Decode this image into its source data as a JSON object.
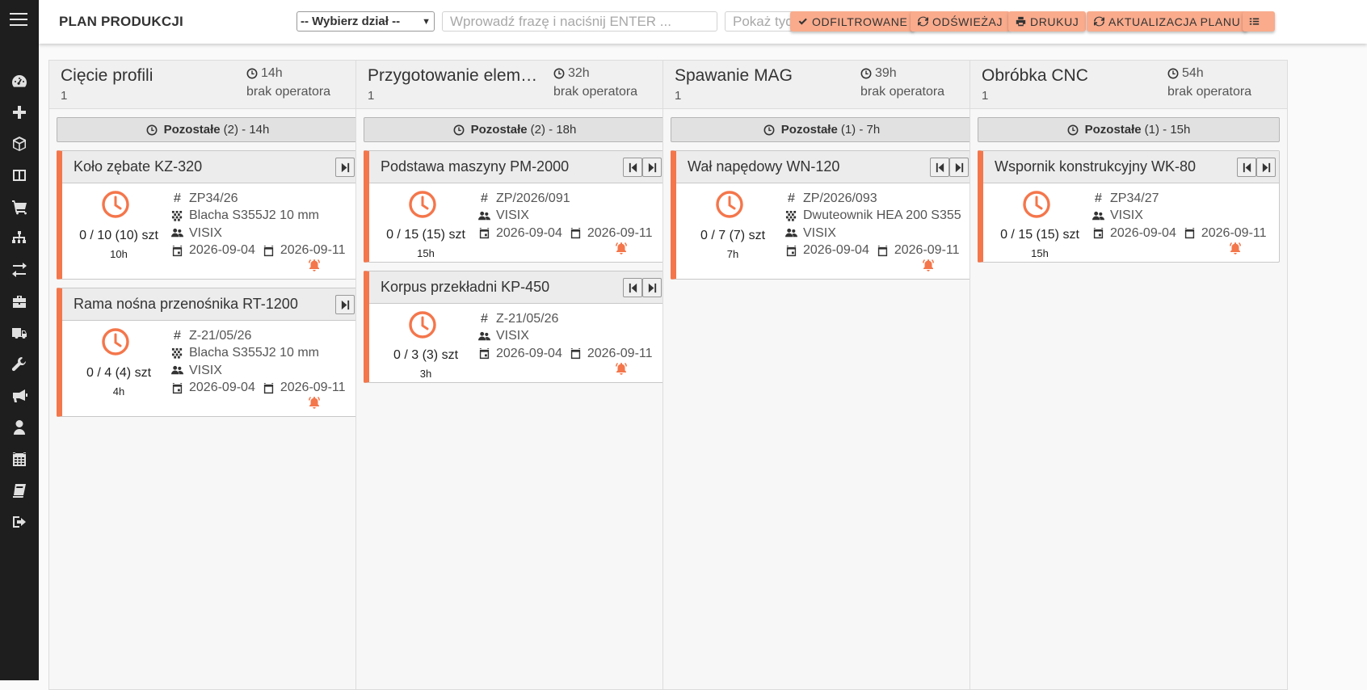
{
  "header": {
    "title": "PLAN PRODUKCJI",
    "dept_select": "-- Wybierz dział --",
    "search_placeholder": "Wprowadź frazę i naciśnij ENTER ...",
    "week_placeholder": "Pokaż tydzień",
    "btn_filtered": "ODFILTROWANE",
    "btn_refresh": "ODŚWIEŻAJ",
    "btn_print": "DRUKUJ",
    "btn_update": "AKTUALIZACJA PLANU"
  },
  "sidebar": {
    "icons": [
      "dashboard-icon",
      "plus-icon",
      "box-icon",
      "columns-icon",
      "cart-icon",
      "sitemap-icon",
      "exchange-icon",
      "briefcase-icon",
      "truck-icon",
      "wrench-icon",
      "megaphone-icon",
      "user-icon",
      "calendar-icon",
      "book-icon",
      "logout-icon"
    ]
  },
  "accent_color": "#f4764b",
  "button_color": "#f9ab8c",
  "columns": [
    {
      "title": "Cięcie profili",
      "count": "1",
      "hours": "14h",
      "operator": "brak operatora",
      "remaining_label": "Pozostałe",
      "remaining_rest": "(2) - 14h",
      "cards": [
        {
          "title": "Koło zębate KZ-320",
          "nav": "next",
          "qty": "0 / 10 (10) szt",
          "hours": "10h",
          "order": "ZP34/26",
          "material": "Blacha S355J2 10 mm",
          "client": "VISIX",
          "start": "2026-09-04",
          "end": "2026-09-11"
        },
        {
          "title": "Rama nośna przenośnika RT-1200",
          "nav": "next",
          "qty": "0 / 4 (4) szt",
          "hours": "4h",
          "order": "Z-21/05/26",
          "material": "Blacha S355J2 10 mm",
          "client": "VISIX",
          "start": "2026-09-04",
          "end": "2026-09-11"
        }
      ]
    },
    {
      "title": "Przygotowanie elementów",
      "count": "1",
      "hours": "32h",
      "operator": "brak operatora",
      "remaining_label": "Pozostałe",
      "remaining_rest": "(2) - 18h",
      "cards": [
        {
          "title": "Podstawa maszyny PM-2000",
          "nav": "both",
          "qty": "0 / 15 (15) szt",
          "hours": "15h",
          "order": "ZP/2026/091",
          "material": "",
          "client": "VISIX",
          "start": "2026-09-04",
          "end": "2026-09-11"
        },
        {
          "title": "Korpus przekładni KP-450",
          "nav": "both",
          "qty": "0 / 3 (3) szt",
          "hours": "3h",
          "order": "Z-21/05/26",
          "material": "",
          "client": "VISIX",
          "start": "2026-09-04",
          "end": "2026-09-11"
        }
      ]
    },
    {
      "title": "Spawanie MAG",
      "count": "1",
      "hours": "39h",
      "operator": "brak operatora",
      "remaining_label": "Pozostałe",
      "remaining_rest": "(1) - 7h",
      "cards": [
        {
          "title": "Wał napędowy WN-120",
          "nav": "both",
          "qty": "0 / 7 (7) szt",
          "hours": "7h",
          "order": "ZP/2026/093",
          "material": "Dwuteownik HEA 200 S355",
          "client": "VISIX",
          "start": "2026-09-04",
          "end": "2026-09-11"
        }
      ]
    },
    {
      "title": "Obróbka CNC",
      "count": "1",
      "hours": "54h",
      "operator": "brak operatora",
      "remaining_label": "Pozostałe",
      "remaining_rest": "(1) - 15h",
      "cards": [
        {
          "title": "Wspornik konstrukcyjny WK-80",
          "nav": "both",
          "qty": "0 / 15 (15) szt",
          "hours": "15h",
          "order": "ZP34/27",
          "material": "",
          "client": "VISIX",
          "start": "2026-09-04",
          "end": "2026-09-11"
        }
      ]
    }
  ]
}
